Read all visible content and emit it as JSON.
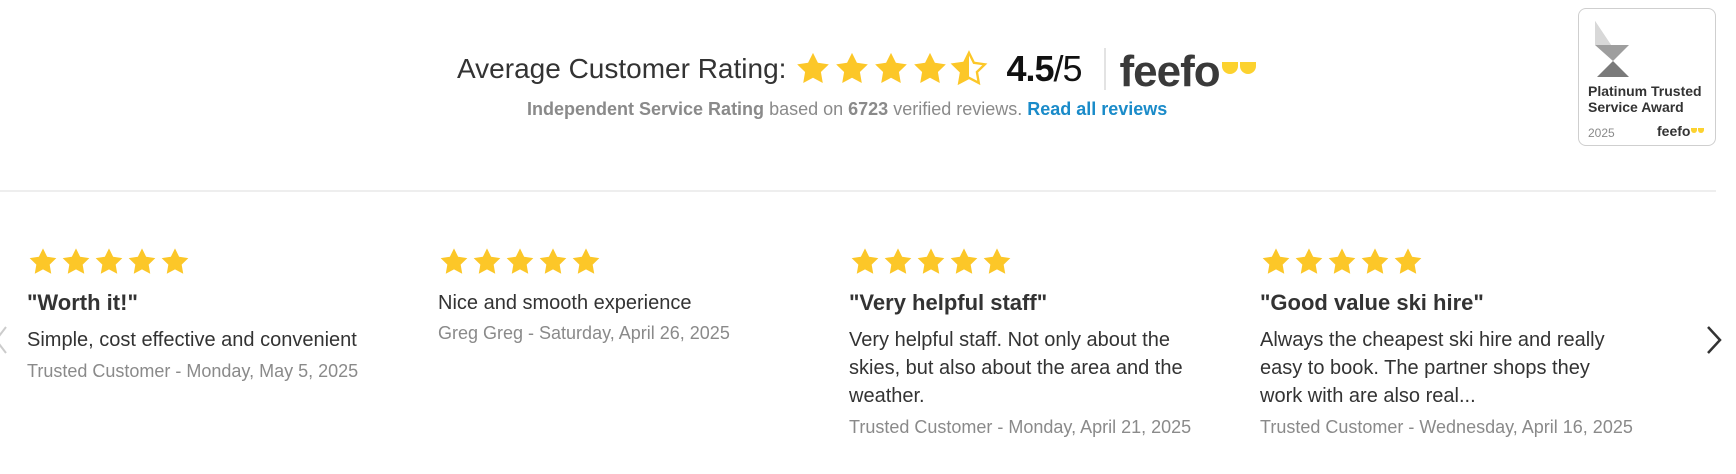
{
  "summary": {
    "label": "Average Customer Rating:",
    "stars_value": 4.5,
    "stars_max": 5,
    "score": "4.5",
    "score_out_of": "/5",
    "brand": "feefo",
    "independent": "Independent Service Rating",
    "based_on": " based on ",
    "count": "6723",
    "verified": " verified reviews. ",
    "read_all": "Read all reviews"
  },
  "award": {
    "title": "Platinum Trusted Service Award",
    "year": "2025",
    "brand": "feefo"
  },
  "colors": {
    "star": "#fcc728",
    "link": "#1a8bc9",
    "muted": "#8a8a8a"
  },
  "reviews": [
    {
      "stars": 5,
      "title": "\"Worth it!\"",
      "body": "Simple, cost effective and convenient",
      "meta": "Trusted Customer - Monday, May 5, 2025"
    },
    {
      "stars": 5,
      "title": "",
      "body": "Nice and smooth experience",
      "meta": "Greg Greg - Saturday, April 26, 2025"
    },
    {
      "stars": 5,
      "title": "\"Very helpful staff\"",
      "body": "Very helpful staff. Not only about the skies, but also about the area and the weather.",
      "meta": "Trusted Customer - Monday, April 21, 2025"
    },
    {
      "stars": 5,
      "title": "\"Good value ski hire\"",
      "body": "Always the cheapest ski hire and really easy to book. The partner shops they work with are also real...",
      "meta": "Trusted Customer - Wednesday, April 16, 2025"
    }
  ],
  "icons": {
    "prev": "chevron-left-icon",
    "next": "chevron-right-icon",
    "star": "star-icon"
  }
}
